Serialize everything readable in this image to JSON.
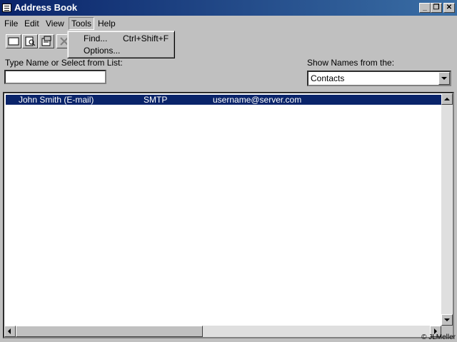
{
  "window": {
    "title": "Address Book"
  },
  "menu": {
    "file": "File",
    "edit": "Edit",
    "view": "View",
    "tools": "Tools",
    "help": "Help"
  },
  "tools_menu": {
    "find_label": "Find...",
    "find_shortcut": "Ctrl+Shift+F",
    "options_label": "Options..."
  },
  "search": {
    "label": "Type Name or Select from List:",
    "value": ""
  },
  "show_names": {
    "label": "Show Names from the:",
    "selected": "Contacts"
  },
  "list": {
    "rows": [
      {
        "name": "John Smith (E-mail)",
        "type": "SMTP",
        "address": "username@server.com"
      }
    ]
  },
  "copyright": "© JLMeller"
}
